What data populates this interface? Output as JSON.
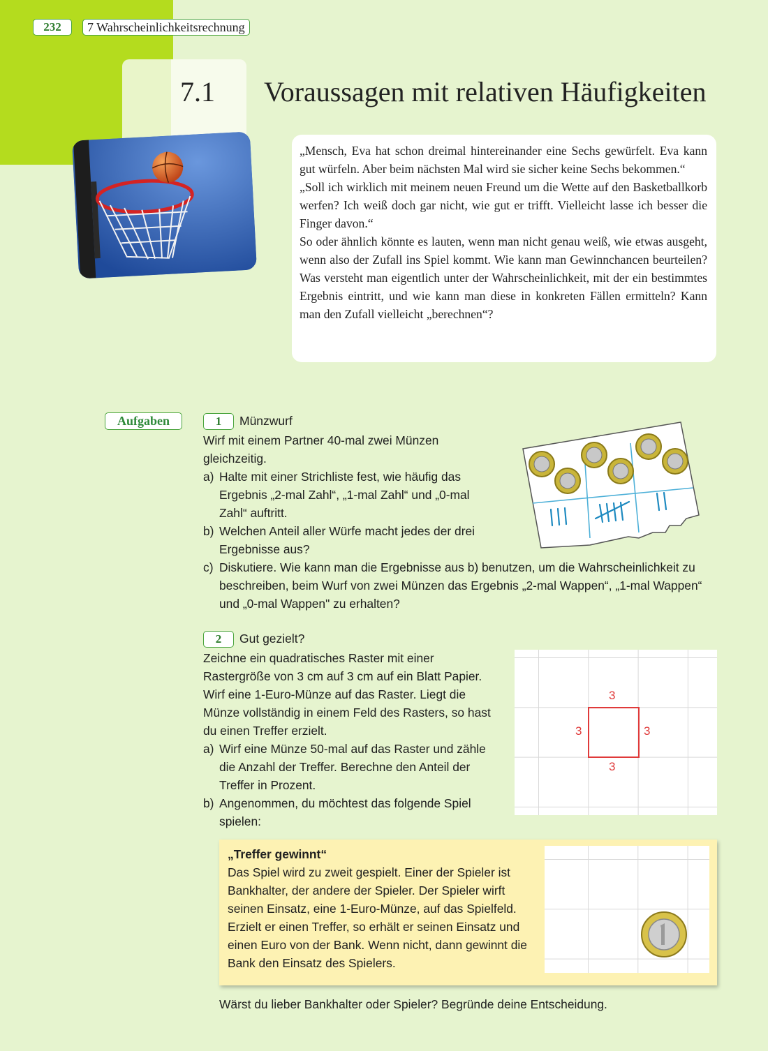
{
  "header": {
    "page_number": "232",
    "chapter": "7 Wahrscheinlichkeitsrechnung"
  },
  "section": {
    "number": "7.1",
    "title": "Voraussagen mit relativen Häufigkeiten"
  },
  "intro": {
    "p1": "„Mensch, Eva hat schon dreimal hintereinander eine Sechs gewürfelt. Eva kann gut würfeln. Aber beim nächsten Mal wird sie sicher keine Sechs bekommen.“",
    "p2": "„Soll ich wirklich mit meinem neuen Freund um die Wette auf den Basketballkorb werfen? Ich weiß doch gar nicht, wie gut er trifft. Vielleicht lasse ich besser die Finger davon.“",
    "p3": "So oder ähnlich könnte es lauten, wenn man nicht genau weiß, wie etwas ausgeht, wenn also der Zufall ins Spiel kommt. Wie kann man Gewinnchancen beurteilen? Was versteht man eigentlich unter der Wahrscheinlichkeit, mit der ein bestimmtes Ergebnis eintritt, und wie kann man diese in konkreten Fällen ermitteln? Kann man den Zufall vielleicht „berechnen“?"
  },
  "aufgaben_label": "Aufgaben",
  "task1": {
    "number": "1",
    "title": "Münzwurf",
    "intro": "Wirf mit einem Partner 40-mal zwei Münzen gleichzeitig.",
    "a_label": "a)",
    "a": "Halte mit einer Strichliste fest, wie häufig das Ergebnis „2-mal Zahl“, „1-mal Zahl“ und „0-mal Zahl“ auftritt.",
    "b_label": "b)",
    "b": "Welchen Anteil aller Würfe macht jedes der drei Ergebnisse aus?",
    "c_label": "c)",
    "c": "Diskutiere. Wie kann man die Ergebnisse aus b) benutzen, um die Wahrscheinlichkeit zu beschreiben, beim Wurf von zwei Münzen das Ergebnis „2-mal Wappen“, „1-mal Wappen“ und „0-mal Wappen\" zu erhalten?"
  },
  "task2": {
    "number": "2",
    "title": "Gut gezielt?",
    "intro": "Zeichne ein quadratisches Raster mit einer Rastergröße von 3 cm auf 3 cm auf ein Blatt Papier. Wirf eine 1-Euro-Münze auf das Raster. Liegt die Münze vollständig in einem Feld des Rasters, so hast du einen Treffer erzielt.",
    "a_label": "a)",
    "a": "Wirf eine Münze 50-mal auf das Raster und zähle die Anzahl der Treffer. Berechne den Anteil der Treffer in Prozent.",
    "b_label": "b)",
    "b": "Angenommen, du möchtest das folgende Spiel spielen:",
    "grid_labels": {
      "top": "3",
      "left": "3",
      "right": "3",
      "bottom": "3"
    },
    "game_title": "„Treffer gewinnt“",
    "game_text": "Das Spiel wird zu zweit gespielt. Einer der Spieler ist Bankhalter, der andere der Spieler. Der Spieler wirft seinen Einsatz, eine 1-Euro-Münze, auf das Spielfeld. Erzielt er einen Treffer, so erhält er seinen Einsatz und einen Euro von der Bank. Wenn nicht, dann gewinnt die Bank den Einsatz des Spielers.",
    "question": "Wärst du lieber Bankhalter oder Spieler? Begründe deine Entscheidung."
  }
}
